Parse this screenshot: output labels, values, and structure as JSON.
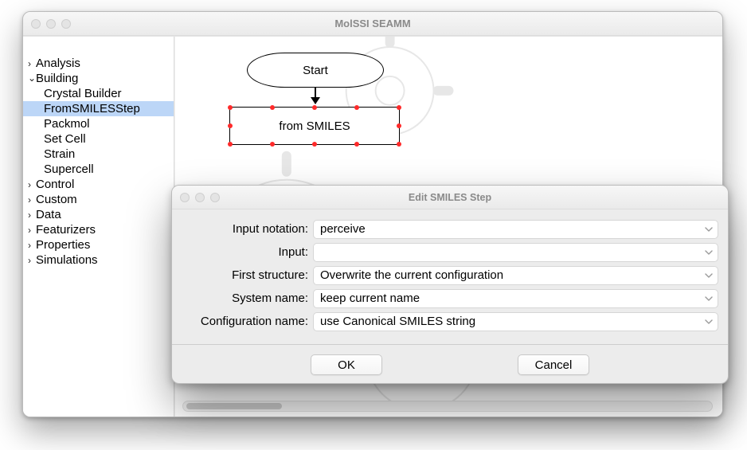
{
  "main_window": {
    "title": "MolSSI SEAMM",
    "tree": [
      {
        "label": "Analysis",
        "expanded": false,
        "children": []
      },
      {
        "label": "Building",
        "expanded": true,
        "children": [
          {
            "label": "Crystal Builder"
          },
          {
            "label": "FromSMILESStep",
            "selected": true
          },
          {
            "label": "Packmol"
          },
          {
            "label": "Set Cell"
          },
          {
            "label": "Strain"
          },
          {
            "label": "Supercell"
          }
        ]
      },
      {
        "label": "Control",
        "expanded": false,
        "children": []
      },
      {
        "label": "Custom",
        "expanded": false,
        "children": []
      },
      {
        "label": "Data",
        "expanded": false,
        "children": []
      },
      {
        "label": "Featurizers",
        "expanded": false,
        "children": []
      },
      {
        "label": "Properties",
        "expanded": false,
        "children": []
      },
      {
        "label": "Simulations",
        "expanded": false,
        "children": []
      }
    ],
    "flow": {
      "start_label": "Start",
      "step_label": "from SMILES"
    }
  },
  "dialog": {
    "title": "Edit SMILES Step",
    "fields": {
      "input_notation": {
        "label": "Input notation:",
        "value": "perceive"
      },
      "input": {
        "label": "Input:",
        "value": ""
      },
      "first_structure": {
        "label": "First structure:",
        "value": "Overwrite the current configuration"
      },
      "system_name": {
        "label": "System name:",
        "value": "keep current name"
      },
      "configuration_name": {
        "label": "Configuration name:",
        "value": "use Canonical SMILES string"
      }
    },
    "buttons": {
      "ok": "OK",
      "cancel": "Cancel"
    }
  }
}
